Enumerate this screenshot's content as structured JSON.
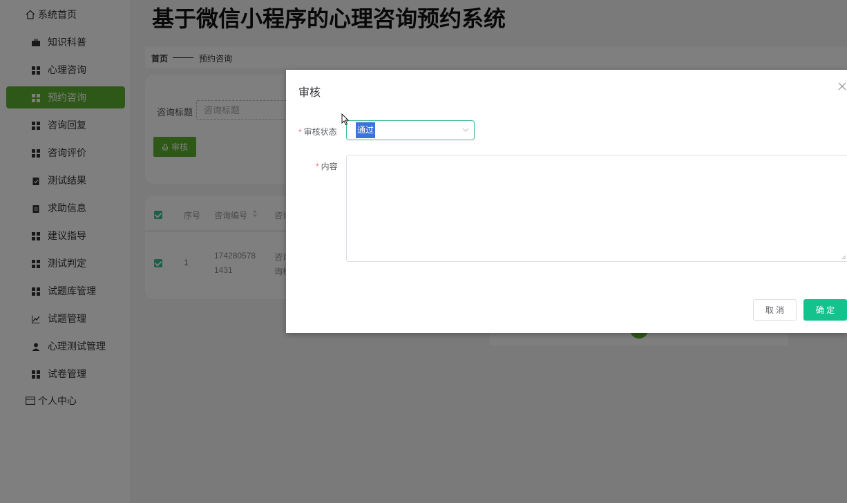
{
  "app_title": "基于微信小程序的心理咨询预约系统",
  "sidebar": {
    "home": "系统首页",
    "items": [
      {
        "label": "知识科普",
        "icon": "briefcase-icon"
      },
      {
        "label": "心理咨询",
        "icon": "grid-icon"
      },
      {
        "label": "预约咨询",
        "icon": "grid-icon",
        "active": true
      },
      {
        "label": "咨询回复",
        "icon": "grid-icon"
      },
      {
        "label": "咨询评价",
        "icon": "grid-icon"
      },
      {
        "label": "测试结果",
        "icon": "clipboard-check-icon"
      },
      {
        "label": "求助信息",
        "icon": "clipboard-icon"
      },
      {
        "label": "建议指导",
        "icon": "grid-icon"
      },
      {
        "label": "测试判定",
        "icon": "grid-icon"
      },
      {
        "label": "试题库管理",
        "icon": "grid-icon"
      },
      {
        "label": "试题管理",
        "icon": "chart-line-icon"
      },
      {
        "label": "心理测试管理",
        "icon": "user-icon"
      },
      {
        "label": "试卷管理",
        "icon": "grid-icon"
      }
    ],
    "personal": "个人中心"
  },
  "breadcrumb": {
    "home": "首页",
    "current": "预约咨询"
  },
  "search": {
    "label": "咨询标题",
    "placeholder": "咨询标题",
    "audit_button": "审核"
  },
  "table": {
    "headers": {
      "index": "序号",
      "consult_no": "咨询编号",
      "consult_title": "咨询"
    },
    "rows": [
      {
        "index": "1",
        "consult_no_line1": "174280578",
        "consult_no_line2": "1431",
        "title_line1": "咨询",
        "title_line2": "询标"
      }
    ]
  },
  "dialog": {
    "title": "审核",
    "status_label": "审核状态",
    "status_value": "通过",
    "content_label": "内容",
    "content_value": "",
    "cancel": "取 消",
    "confirm": "确 定"
  },
  "colors": {
    "accent": "#5ab12f",
    "confirm": "#13c28c",
    "focus": "#3cbf8f"
  }
}
